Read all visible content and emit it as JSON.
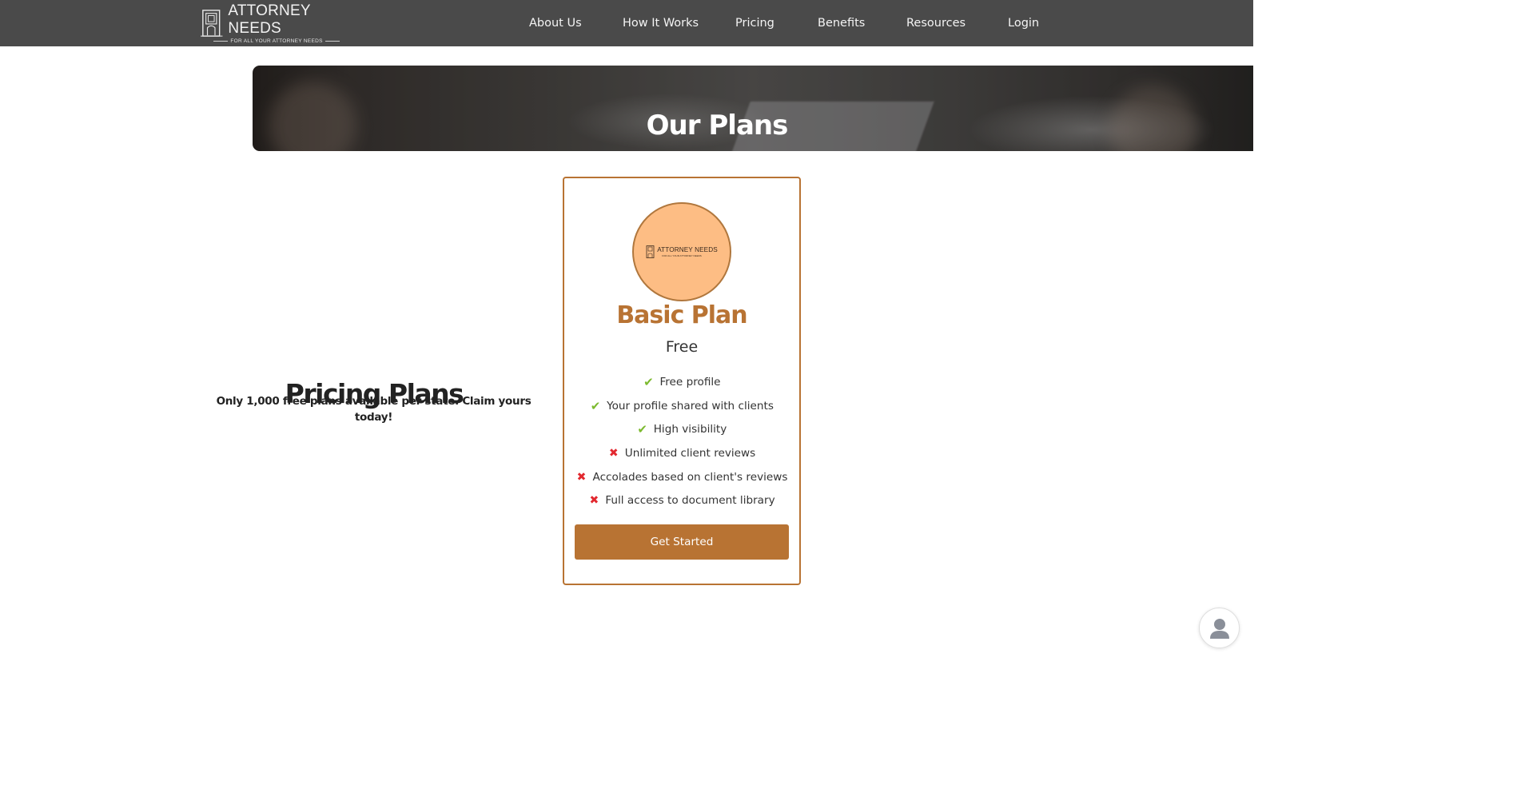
{
  "brand": {
    "name": "ATTORNEY NEEDS",
    "tagline": "FOR ALL YOUR ATTORNEY NEEDS"
  },
  "nav": {
    "items": [
      {
        "label": "About Us"
      },
      {
        "label": "How It Works"
      },
      {
        "label": "Pricing"
      },
      {
        "label": "Benefits"
      },
      {
        "label": "Resources"
      },
      {
        "label": "Login"
      }
    ]
  },
  "hero": {
    "title": "Our Plans"
  },
  "intro": {
    "title": "Pricing Plans",
    "subtitle": "Only 1,000 free plans available per state. Claim yours today!"
  },
  "plan": {
    "badge_title": "ATTORNEY NEEDS",
    "badge_tagline": "FOR ALL YOUR ATTORNEY NEEDS",
    "name": "Basic Plan",
    "price": "Free",
    "features": [
      {
        "text": "Free profile",
        "included": true
      },
      {
        "text": "Your profile shared with clients",
        "included": true
      },
      {
        "text": "High visibility",
        "included": true
      },
      {
        "text": "Unlimited client reviews",
        "included": false
      },
      {
        "text": "Accolades based on client's reviews",
        "included": false
      },
      {
        "text": "Full access to document library",
        "included": false
      }
    ],
    "cta_label": "Get Started"
  },
  "icons": {
    "included": "check-icon",
    "excluded": "x-icon",
    "chat": "user-avatar-icon"
  },
  "colors": {
    "nav_bg": "#4a4a4a",
    "accent": "#b87333",
    "badge_fill": "#fdbd84",
    "check": "#7cba2f",
    "cross": "#e2282f"
  }
}
